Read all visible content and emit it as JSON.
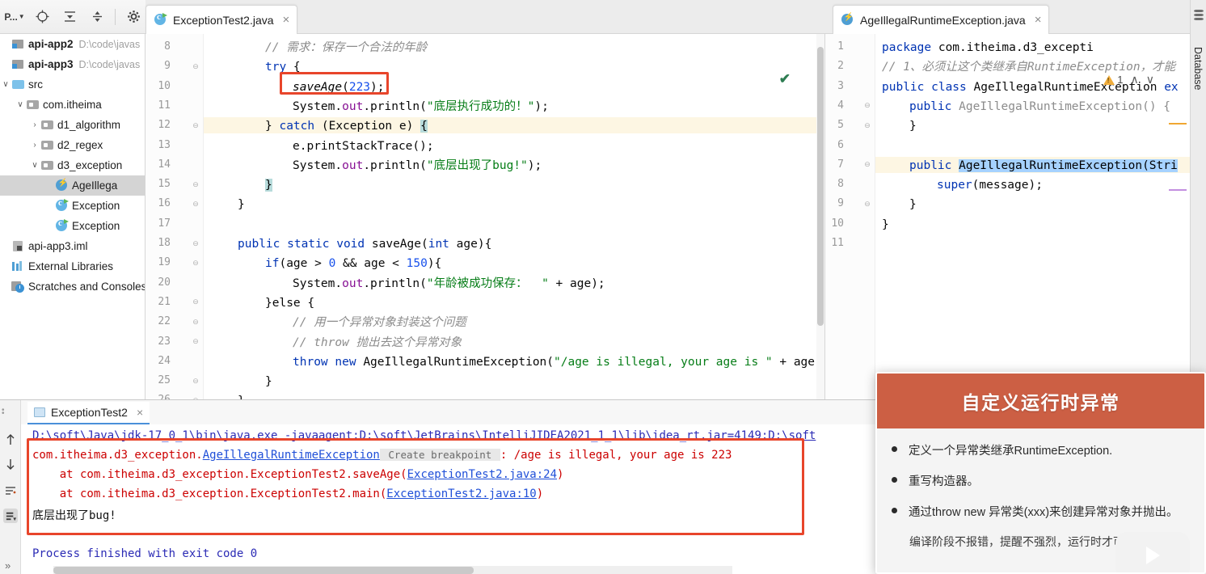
{
  "project_toolbar": {
    "selector_label": "P...",
    "icons": [
      "project-selector",
      "locate-icon",
      "collapse-expand-icon",
      "collapse-all-icon",
      "settings-gear-icon"
    ]
  },
  "project_tree": [
    {
      "indent": 0,
      "chevron": "",
      "icon": "module-icon",
      "label": "api-app2",
      "bold": true,
      "path": "D:\\code\\javas",
      "selected": false
    },
    {
      "indent": 0,
      "chevron": "",
      "icon": "module-icon",
      "label": "api-app3",
      "bold": true,
      "path": "D:\\code\\javas",
      "selected": false
    },
    {
      "indent": 0,
      "chevron": "∨",
      "icon": "source-folder-icon",
      "label": "src",
      "bold": false,
      "path": "",
      "selected": false
    },
    {
      "indent": 1,
      "chevron": "∨",
      "icon": "package-icon",
      "label": "com.itheima",
      "bold": false,
      "path": "",
      "selected": false
    },
    {
      "indent": 2,
      "chevron": "›",
      "icon": "package-icon",
      "label": "d1_algorithm",
      "bold": false,
      "path": "",
      "selected": false
    },
    {
      "indent": 2,
      "chevron": "›",
      "icon": "package-icon",
      "label": "d2_regex",
      "bold": false,
      "path": "",
      "selected": false
    },
    {
      "indent": 2,
      "chevron": "∨",
      "icon": "package-icon",
      "label": "d3_exception",
      "bold": false,
      "path": "",
      "selected": false
    },
    {
      "indent": 3,
      "chevron": "",
      "icon": "exception-class-icon",
      "label": "AgeIllega",
      "bold": false,
      "path": "",
      "selected": true
    },
    {
      "indent": 3,
      "chevron": "",
      "icon": "java-class-icon",
      "label": "Exception",
      "bold": false,
      "path": "",
      "selected": false
    },
    {
      "indent": 3,
      "chevron": "",
      "icon": "java-class-icon",
      "label": "Exception",
      "bold": false,
      "path": "",
      "selected": false
    },
    {
      "indent": 0,
      "chevron": "",
      "icon": "iml-file-icon",
      "label": "api-app3.iml",
      "bold": false,
      "path": "",
      "selected": false
    },
    {
      "indent": -1,
      "chevron": "",
      "icon": "library-icon",
      "label": "External Libraries",
      "bold": false,
      "path": "",
      "selected": false
    },
    {
      "indent": -1,
      "chevron": "",
      "icon": "scratches-icon",
      "label": "Scratches and Consoles",
      "bold": false,
      "path": "",
      "selected": false
    }
  ],
  "editor_left": {
    "tab_label": "ExceptionTest2.java",
    "tab_icon": "java-class-icon",
    "tab_close": "×",
    "inspection_status": "✔",
    "first_line_number": 8,
    "lines": [
      {
        "n": 8,
        "indent": 4,
        "tokens": [
          {
            "t": "// 需求：保存一个合法的年龄",
            "c": "cmt"
          }
        ]
      },
      {
        "n": 9,
        "indent": 4,
        "fold": "⊖",
        "tokens": [
          {
            "t": "try",
            "c": "kw"
          },
          {
            "t": " {",
            "c": "pln"
          }
        ]
      },
      {
        "n": 10,
        "indent": 6,
        "tokens": [
          {
            "t": "saveAge",
            "c": "mth"
          },
          {
            "t": "(",
            "c": "pln"
          },
          {
            "t": "223",
            "c": "num"
          },
          {
            "t": ");",
            "c": "pln"
          }
        ]
      },
      {
        "n": 11,
        "indent": 6,
        "tokens": [
          {
            "t": "System.",
            "c": "pln"
          },
          {
            "t": "out",
            "c": "fld"
          },
          {
            "t": ".println(",
            "c": "pln"
          },
          {
            "t": "\"底层执行成功的！\"",
            "c": "str"
          },
          {
            "t": ");",
            "c": "pln"
          }
        ]
      },
      {
        "n": 12,
        "indent": 4,
        "fold": "⊖",
        "highlight": true,
        "tokens": [
          {
            "t": "} ",
            "c": "pln"
          },
          {
            "t": "catch",
            "c": "kw"
          },
          {
            "t": " (Exception e) ",
            "c": "pln"
          },
          {
            "t": "{",
            "c": "sel-brace"
          }
        ]
      },
      {
        "n": 13,
        "indent": 6,
        "tokens": [
          {
            "t": "e.printStackTrace();",
            "c": "pln"
          }
        ]
      },
      {
        "n": 14,
        "indent": 6,
        "tokens": [
          {
            "t": "System.",
            "c": "pln"
          },
          {
            "t": "out",
            "c": "fld"
          },
          {
            "t": ".println(",
            "c": "pln"
          },
          {
            "t": "\"底层出现了bug!\"",
            "c": "str"
          },
          {
            "t": ");",
            "c": "pln"
          }
        ]
      },
      {
        "n": 15,
        "indent": 4,
        "fold": "⊖",
        "tokens": [
          {
            "t": "}",
            "c": "sel-brace"
          }
        ]
      },
      {
        "n": 16,
        "indent": 2,
        "fold": "⊖",
        "tokens": [
          {
            "t": "}",
            "c": "pln"
          }
        ]
      },
      {
        "n": 17,
        "indent": 0,
        "tokens": [
          {
            "t": "",
            "c": "pln"
          }
        ]
      },
      {
        "n": 18,
        "indent": 2,
        "fold": "⊖",
        "tokens": [
          {
            "t": "public static void ",
            "c": "kw"
          },
          {
            "t": "saveAge",
            "c": "pln"
          },
          {
            "t": "(",
            "c": "pln"
          },
          {
            "t": "int",
            "c": "kw"
          },
          {
            "t": " age){",
            "c": "pln"
          }
        ]
      },
      {
        "n": 19,
        "indent": 4,
        "fold": "⊖",
        "tokens": [
          {
            "t": "if",
            "c": "kw"
          },
          {
            "t": "(age > ",
            "c": "pln"
          },
          {
            "t": "0",
            "c": "num"
          },
          {
            "t": " && age < ",
            "c": "pln"
          },
          {
            "t": "150",
            "c": "num"
          },
          {
            "t": "){",
            "c": "pln"
          }
        ]
      },
      {
        "n": 20,
        "indent": 6,
        "tokens": [
          {
            "t": "System.",
            "c": "pln"
          },
          {
            "t": "out",
            "c": "fld"
          },
          {
            "t": ".println(",
            "c": "pln"
          },
          {
            "t": "\"年龄被成功保存：  \"",
            "c": "str"
          },
          {
            "t": " + age);",
            "c": "pln"
          }
        ]
      },
      {
        "n": 21,
        "indent": 4,
        "fold": "⊖",
        "tokens": [
          {
            "t": "}else {",
            "c": "pln"
          }
        ]
      },
      {
        "n": 22,
        "indent": 6,
        "fold": "⊖",
        "tokens": [
          {
            "t": "// 用一个异常对象封装这个问题",
            "c": "cmt"
          }
        ]
      },
      {
        "n": 23,
        "indent": 6,
        "fold": "⊖",
        "tokens": [
          {
            "t": "// throw 抛出去这个异常对象",
            "c": "cmt"
          }
        ]
      },
      {
        "n": 24,
        "indent": 6,
        "tokens": [
          {
            "t": "throw new ",
            "c": "kw"
          },
          {
            "t": "AgeIllegalRuntimeException(",
            "c": "pln"
          },
          {
            "t": "\"/age is illegal, your age is \"",
            "c": "str"
          },
          {
            "t": " + age)",
            "c": "pln"
          }
        ]
      },
      {
        "n": 25,
        "indent": 4,
        "fold": "⊖",
        "tokens": [
          {
            "t": "}",
            "c": "pln"
          }
        ]
      },
      {
        "n": 26,
        "indent": 2,
        "fold": "⊖",
        "tokens": [
          {
            "t": "}",
            "c": "pln"
          }
        ]
      }
    ]
  },
  "editor_right": {
    "tab_label": "AgeIllegalRuntimeException.java",
    "tab_icon": "exception-class-icon",
    "tab_close": "×",
    "warning_count": "1",
    "warning_icon": "warning-triangle-icon",
    "nav_up": "∧",
    "nav_down": "∨",
    "lines": [
      {
        "n": 1,
        "indent": 0,
        "tokens": [
          {
            "t": "package",
            "c": "kw"
          },
          {
            "t": " com.itheima.d3_excepti",
            "c": "pln"
          }
        ]
      },
      {
        "n": 2,
        "indent": 0,
        "tokens": [
          {
            "t": "// 1、必须让这个类继承自RuntimeException，才能",
            "c": "cmt"
          }
        ]
      },
      {
        "n": 3,
        "indent": 0,
        "tokens": [
          {
            "t": "public class ",
            "c": "kw"
          },
          {
            "t": "AgeIllegalRuntimeException ",
            "c": "pln"
          },
          {
            "t": "eх",
            "c": "kw"
          }
        ]
      },
      {
        "n": 4,
        "indent": 2,
        "fold": "⊖",
        "tokens": [
          {
            "t": "public",
            "c": "kw"
          },
          {
            "t": " ",
            "c": "pln"
          },
          {
            "t": "AgeIllegalRuntimeException() {",
            "c": "o-gray"
          }
        ]
      },
      {
        "n": 5,
        "indent": 2,
        "fold": "⊖",
        "tokens": [
          {
            "t": "}",
            "c": "pln"
          }
        ]
      },
      {
        "n": 6,
        "indent": 0,
        "tokens": [
          {
            "t": "",
            "c": "pln"
          }
        ]
      },
      {
        "n": 7,
        "indent": 2,
        "fold": "⊖",
        "highlight": true,
        "tokens": [
          {
            "t": "public ",
            "c": "kw"
          },
          {
            "t": "AgeIllegalRuntimeException(Stri",
            "c": "hl-select"
          }
        ]
      },
      {
        "n": 8,
        "indent": 4,
        "tokens": [
          {
            "t": "super",
            "c": "kw"
          },
          {
            "t": "(message);",
            "c": "pln"
          }
        ]
      },
      {
        "n": 9,
        "indent": 2,
        "fold": "⊖",
        "tokens": [
          {
            "t": "}",
            "c": "pln"
          }
        ]
      },
      {
        "n": 10,
        "indent": 0,
        "tokens": [
          {
            "t": "}",
            "c": "pln"
          }
        ]
      },
      {
        "n": 11,
        "indent": 0,
        "tokens": [
          {
            "t": "",
            "c": "pln"
          }
        ]
      }
    ]
  },
  "database_bar": {
    "label": "Database",
    "icon": "database-icon"
  },
  "console": {
    "tab_label": "ExceptionTest2",
    "tab_icon": "console-window-icon",
    "tab_close": "×",
    "toolbar_icons": [
      "scroll-up-icon",
      "scroll-down-icon",
      "soft-wrap-icon",
      "print-icon"
    ],
    "expander": "»",
    "lines": [
      {
        "segments": [
          {
            "t": "D:\\soft\\Java\\jdk-17_0_1\\bin\\java.exe -javaagent:D:\\soft\\JetBrains\\IntelliJIDEA2021_1_1\\lib\\idea_rt.jar=4149:D:\\soft",
            "c": "o-info o-link"
          }
        ]
      },
      {
        "segments": [
          {
            "t": "com.itheima.d3_exception.",
            "c": "o-err"
          },
          {
            "t": "AgeIllegalRuntimeException",
            "c": "o-link"
          },
          {
            "t": " Create breakpoint ",
            "c": "o-bp"
          },
          {
            "t": ": /age is illegal, your age is 223",
            "c": "o-err"
          }
        ]
      },
      {
        "segments": [
          {
            "t": "    at com.itheima.d3_exception.ExceptionTest2.saveAge(",
            "c": "o-err"
          },
          {
            "t": "ExceptionTest2.java:24",
            "c": "o-link"
          },
          {
            "t": ")",
            "c": "o-err"
          }
        ]
      },
      {
        "segments": [
          {
            "t": "    at com.itheima.d3_exception.ExceptionTest2.main(",
            "c": "o-err"
          },
          {
            "t": "ExceptionTest2.java:10",
            "c": "o-link"
          },
          {
            "t": ")",
            "c": "o-err"
          }
        ]
      },
      {
        "segments": [
          {
            "t": "底层出现了bug!",
            "c": "o-blk"
          }
        ]
      },
      {
        "segments": [
          {
            "t": "Process finished with exit code 0",
            "c": "o-info"
          }
        ]
      }
    ]
  },
  "slide": {
    "title": "自定义运行时异常",
    "header_color": "#cc5f44",
    "bullets": [
      "定义一个异常类继承RuntimeException.",
      "重写构造器。",
      "通过throw new 异常类(xxx)来创建异常对象并抛出。"
    ],
    "subnote": "编译阶段不报错，提醒不强烈，运行时才可能出现",
    "play_icon": "play-button-icon"
  },
  "annotations": {
    "red_box_color": "#e8452b"
  }
}
